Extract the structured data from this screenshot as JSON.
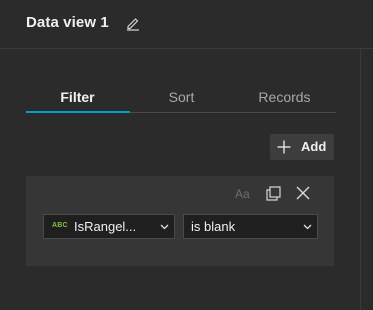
{
  "header": {
    "title": "Data view 1",
    "edit_icon": "pencil-icon"
  },
  "tabs": [
    {
      "label": "Filter",
      "active": true
    },
    {
      "label": "Sort",
      "active": false
    },
    {
      "label": "Records",
      "active": false
    }
  ],
  "actions": {
    "add_label": "Add",
    "add_icon": "plus-icon"
  },
  "filter": {
    "case_toggle": "Aa",
    "field": {
      "type_badge": "ABC",
      "label": "IsRangel...",
      "type_icon": "string-field-icon"
    },
    "operator": {
      "label": "is blank"
    }
  },
  "colors": {
    "accent": "#00a0c6",
    "background": "#2b2b2b",
    "card": "#363636",
    "string_badge": "#7fc241"
  }
}
